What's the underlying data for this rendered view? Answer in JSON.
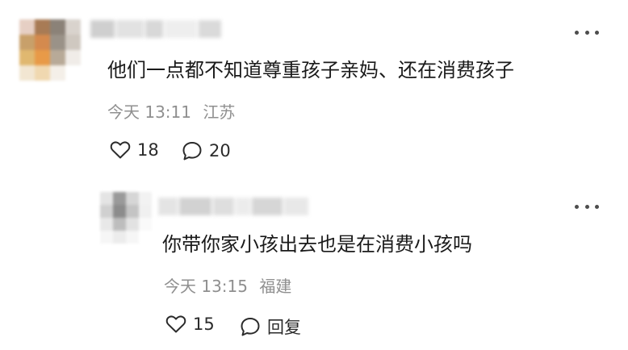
{
  "comments": [
    {
      "username": "",
      "text": "他们一点都不知道尊重孩子亲妈、还在消费孩子",
      "time": "今天 13:11",
      "location": "江苏",
      "likes": "18",
      "replies": "20",
      "avatar_colors": [
        "#e6cfc4",
        "#a87b55",
        "#8b8278",
        "#d9d3cd",
        "#c8a06a",
        "#d48a4e",
        "#9a9288",
        "#cfc8c0",
        "#e0b870",
        "#e89a48",
        "#b8aa98",
        "#f0ece8",
        "#f2e6d2",
        "#f0d8b0",
        "#f4efe8",
        "#ffffff"
      ]
    },
    {
      "username": "",
      "text": "你带你家小孩出去也是在消费小孩吗",
      "time": "今天 13:15",
      "location": "福建",
      "likes": "15",
      "reply_label": "回复",
      "avatar_colors": [
        "#e4e4e4",
        "#9a9a9a",
        "#d6d6d6",
        "#f2f2f2",
        "#d0d0d0",
        "#8c8c8c",
        "#c4c4c4",
        "#f0f0f0",
        "#e8e8e8",
        "#bdbdbd",
        "#e2e2e2",
        "#fafafa",
        "#f6f6f6",
        "#ececec",
        "#f6f6f6",
        "#ffffff"
      ]
    }
  ],
  "icons": {
    "more": "more-icon",
    "like": "heart-icon",
    "reply": "speech-bubble-icon"
  },
  "colors": {
    "text": "#1a1a1a",
    "meta": "#8f8f8f",
    "icon": "#2b2b2b"
  }
}
